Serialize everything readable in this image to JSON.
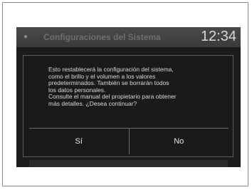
{
  "header": {
    "menu_icon": "menu-icon",
    "title": "Configuraciones del Sistema",
    "clock": "12:34"
  },
  "dialog": {
    "message": "Esto restablecerá la configuración del sistema,\ncomo el brillo y el volumen a los valores\npredeterminados. También se borrarán todos\nlos datos personales.\nConsulte el manual del propietario para obtener\nmás detalles. ¿Desea continuar?",
    "yes_label": "Sí",
    "no_label": "No"
  }
}
